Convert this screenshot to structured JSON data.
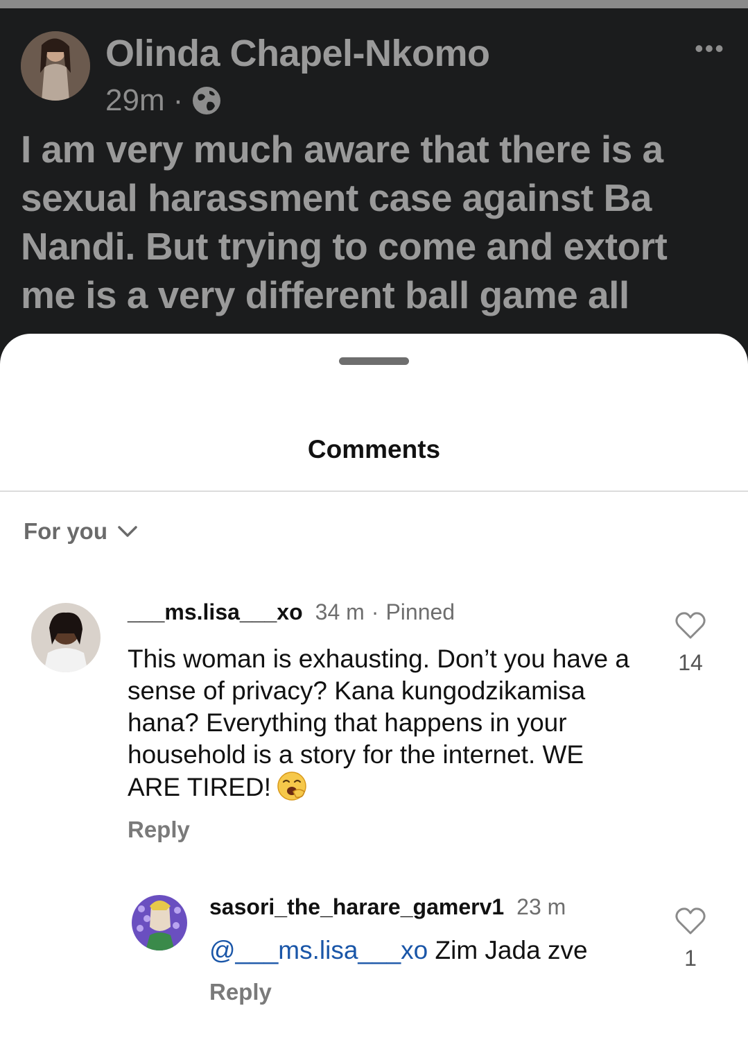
{
  "post": {
    "author": "Olinda Chapel-Nkomo",
    "time": "29m",
    "separator": "·",
    "text": "I am very much aware that there is a sexual harassment case against Ba Nandi. But trying to come and extort me is a very different  ball game all"
  },
  "sheet": {
    "title": "Comments",
    "sort_label": "For you"
  },
  "comments": [
    {
      "username": "___ms.lisa___xo",
      "time": "34 m",
      "separator": "·",
      "pinned_label": "Pinned",
      "text": "This woman is exhausting. Don’t you have a sense of privacy? Kana kungodzikamisa hana? Everything that happens in your household is a story for the internet. WE ARE TIRED!",
      "emoji": "😪",
      "reply_label": "Reply",
      "likes": "14",
      "replies": [
        {
          "username": "sasori_the_harare_gamerv1",
          "time": "23 m",
          "mention": "@___ms.lisa___xo",
          "text": " Zim Jada zve",
          "reply_label": "Reply",
          "likes": "1"
        }
      ]
    }
  ],
  "colors": {
    "post_bg": "#1b1c1d",
    "post_text": "#9a9a9a",
    "mention": "#1a56a8"
  }
}
